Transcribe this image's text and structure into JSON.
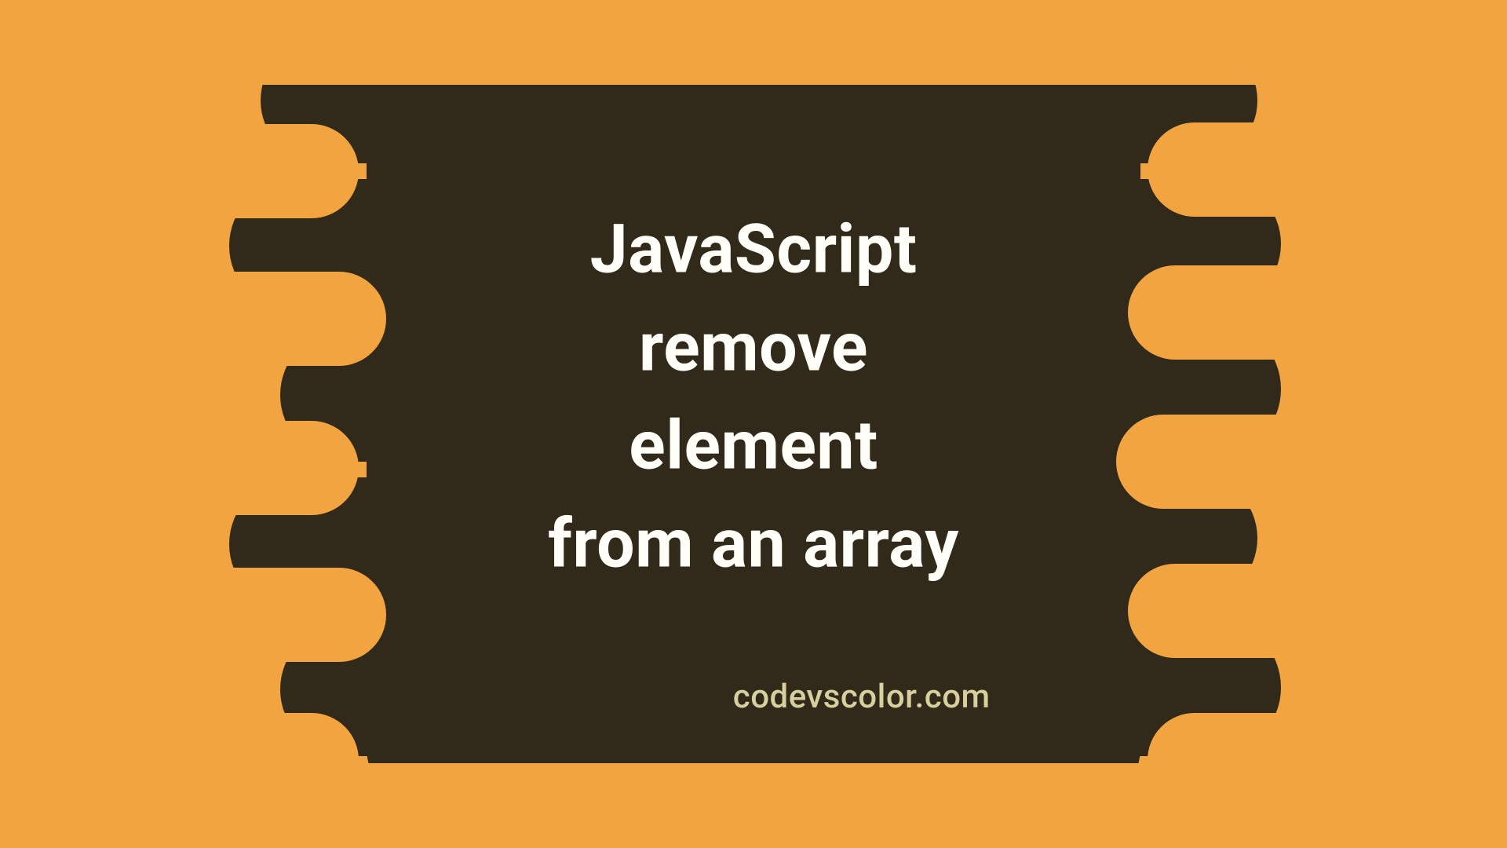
{
  "title": {
    "lines": [
      "JavaScript",
      "remove",
      "element",
      "from an array"
    ]
  },
  "watermark": "codevscolor.com",
  "colors": {
    "background": "#f2a441",
    "blob": "#312a1a",
    "title_text": "#fffef8",
    "watermark_text": "#d7cf9d"
  }
}
